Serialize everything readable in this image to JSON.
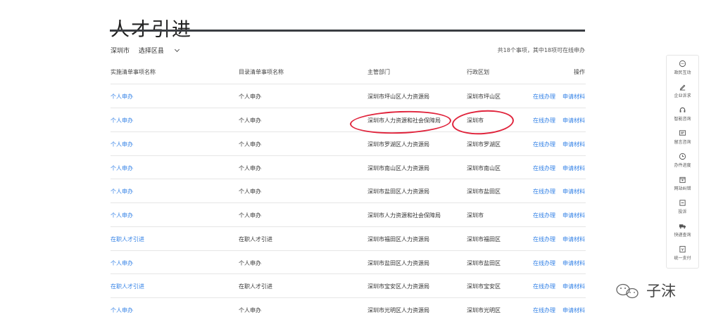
{
  "page": {
    "title": "人才引进"
  },
  "filter": {
    "city": "深圳市",
    "district_select": "选择区县"
  },
  "summary": "共18个事项，其中18项可在线申办",
  "table": {
    "headers": [
      "实施清单事项名称",
      "目录清单事项名称",
      "主管部门",
      "行政区划",
      "操作"
    ],
    "rows": [
      [
        "个人申办",
        "个人申办",
        "深圳市坪山区人力资源局",
        "深圳市坪山区",
        "在线办理",
        "申请材料"
      ],
      [
        "个人申办",
        "个人申办",
        "深圳市人力资源和社会保障局",
        "深圳市",
        "在线办理",
        "申请材料"
      ],
      [
        "个人申办",
        "个人申办",
        "深圳市罗湖区人力资源局",
        "深圳市罗湖区",
        "在线办理",
        "申请材料"
      ],
      [
        "个人申办",
        "个人申办",
        "深圳市南山区人力资源局",
        "深圳市南山区",
        "在线办理",
        "申请材料"
      ],
      [
        "个人申办",
        "个人申办",
        "深圳市盐田区人力资源局",
        "深圳市盐田区",
        "在线办理",
        "申请材料"
      ],
      [
        "个人申办",
        "个人申办",
        "深圳市人力资源和社会保障局",
        "深圳市",
        "在线办理",
        "申请材料"
      ],
      [
        "在职人才引进",
        "在职人才引进",
        "深圳市福田区人力资源局",
        "深圳市福田区",
        "在线办理",
        "申请材料"
      ],
      [
        "个人申办",
        "个人申办",
        "深圳市盐田区人力资源局",
        "深圳市盐田区",
        "在线办理",
        "申请材料"
      ],
      [
        "在职人才引进",
        "在职人才引进",
        "深圳市宝安区人力资源局",
        "深圳市宝安区",
        "在线办理",
        "申请材料"
      ],
      [
        "个人申办",
        "个人申办",
        "深圳市光明区人力资源局",
        "深圳市光明区",
        "在线办理",
        "申请材料"
      ]
    ]
  },
  "sidebar": {
    "items": [
      {
        "label": "政民互动",
        "icon": "chat-bubble-icon"
      },
      {
        "label": "企业诉求",
        "icon": "pen-icon"
      },
      {
        "label": "智能咨询",
        "icon": "headset-icon"
      },
      {
        "label": "留言咨询",
        "icon": "message-icon"
      },
      {
        "label": "办件进度",
        "icon": "clock-icon"
      },
      {
        "label": "网站纠错",
        "icon": "calendar-icon"
      },
      {
        "label": "投诉",
        "icon": "complaint-icon"
      },
      {
        "label": "快递查询",
        "icon": "truck-icon"
      },
      {
        "label": "统一支付",
        "icon": "payment-icon"
      }
    ]
  },
  "watermark": {
    "text": "子沫"
  },
  "colors": {
    "link": "#2f7fe6",
    "annotation": "#e0243c",
    "rule": "#3a3d42"
  }
}
